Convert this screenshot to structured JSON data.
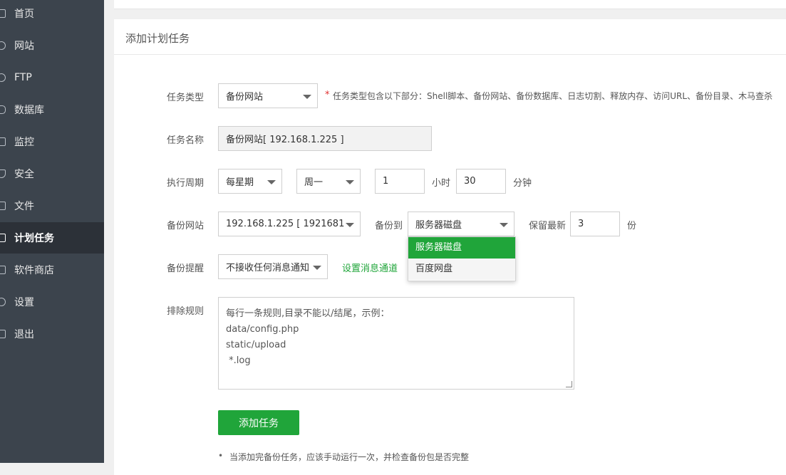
{
  "sidebar": {
    "items": [
      {
        "label": "首页",
        "icon": "home-icon"
      },
      {
        "label": "网站",
        "icon": "globe-icon"
      },
      {
        "label": "FTP",
        "icon": "ftp-icon"
      },
      {
        "label": "数据库",
        "icon": "database-icon"
      },
      {
        "label": "监控",
        "icon": "monitor-icon"
      },
      {
        "label": "安全",
        "icon": "shield-icon"
      },
      {
        "label": "文件",
        "icon": "folder-icon"
      },
      {
        "label": "计划任务",
        "icon": "calendar-icon",
        "active": true
      },
      {
        "label": "软件商店",
        "icon": "grid-icon"
      },
      {
        "label": "设置",
        "icon": "gear-icon"
      },
      {
        "label": "退出",
        "icon": "logout-icon"
      }
    ]
  },
  "panel": {
    "title": "添加计划任务"
  },
  "form": {
    "task_type": {
      "label": "任务类型",
      "value": "备份网站",
      "note": "任务类型包含以下部分：Shell脚本、备份网站、备份数据库、日志切割、释放内存、访问URL、备份目录、木马查杀",
      "required_mark": "*"
    },
    "task_name": {
      "label": "任务名称",
      "value": "备份网站[ 192.168.1.225 ]"
    },
    "period": {
      "label": "执行周期",
      "cycle": "每星期",
      "weekday": "周一",
      "hour": "1",
      "hour_unit": "小时",
      "minute": "30",
      "minute_unit": "分钟"
    },
    "backup_site": {
      "label": "备份网站",
      "value": "192.168.1.225 [ 192168122...",
      "backup_to_label": "备份到",
      "backup_to": "服务器磁盘",
      "keep_label": "保留最新",
      "keep_value": "3",
      "keep_unit": "份"
    },
    "dropdown_options": [
      "服务器磁盘",
      "百度网盘"
    ],
    "notify": {
      "label": "备份提醒",
      "value": "不接收任何消息通知",
      "link": "设置消息通道"
    },
    "exclude": {
      "label": "排除规则",
      "lines": [
        "每行一条规则,目录不能以/结尾，示例：",
        "data/config.php",
        "static/upload",
        " *.log"
      ]
    },
    "submit_label": "添加任务",
    "tip": "当添加完备份任务，应该手动运行一次，并检查备份包是否完整"
  },
  "colors": {
    "accent": "#20a53a",
    "sidebar": "#3c444d",
    "sidebar_active": "#2c3138",
    "required": "#e03131"
  }
}
